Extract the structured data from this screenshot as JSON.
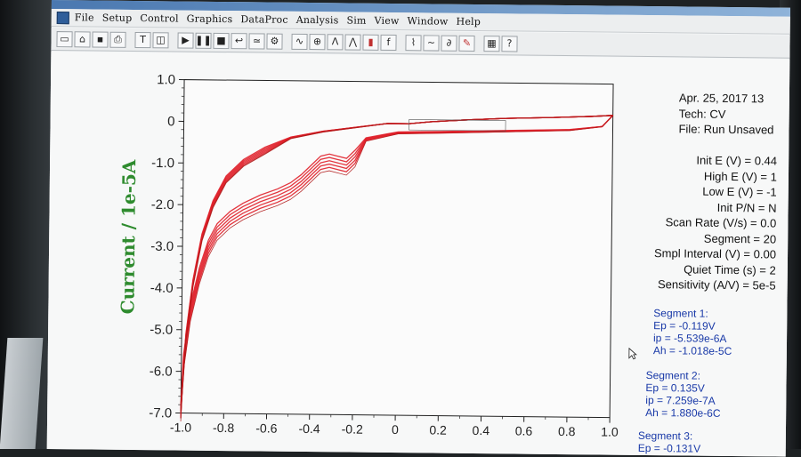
{
  "menu": {
    "items": [
      "File",
      "Setup",
      "Control",
      "Graphics",
      "DataProc",
      "Analysis",
      "Sim",
      "View",
      "Window",
      "Help"
    ]
  },
  "toolbar": {
    "icons": [
      "new-file-icon",
      "open-file-icon",
      "save-icon",
      "print-icon",
      "text-icon",
      "frame-icon",
      "run-icon",
      "pause-icon",
      "stop-icon",
      "reverse-icon",
      "smooth-icon",
      "settings-icon",
      "graph-icon",
      "zoom-icon",
      "peak-icon",
      "overlay-icon",
      "bar-chart-icon",
      "font-icon",
      "baseline-icon",
      "wave-icon",
      "derivative-icon",
      "pen-icon",
      "grid-icon",
      "help-icon"
    ]
  },
  "header": {
    "date": "Apr. 25, 2017   13",
    "tech": "Tech: CV",
    "file": "File: Run Unsaved"
  },
  "parameters": [
    "Init E (V) = 0.44",
    "High E (V) = 1",
    "Low E (V) = -1",
    "Init P/N = N",
    "Scan Rate (V/s) = 0.0",
    "Segment = 20",
    "Smpl Interval (V) = 0.00",
    "Quiet Time (s) = 2",
    "Sensitivity (A/V) = 5e-5"
  ],
  "segments": [
    {
      "title": "Segment 1:",
      "ep": "Ep = -0.119V",
      "ip": "ip = -5.539e-6A",
      "ah": "Ah = -1.018e-5C"
    },
    {
      "title": "Segment 2:",
      "ep": "Ep = 0.135V",
      "ip": "ip = 7.259e-7A",
      "ah": "Ah = 1.880e-6C"
    },
    {
      "title": "Segment 3:",
      "ep": "Ep = -0.131V"
    }
  ],
  "chart_data": {
    "type": "line",
    "ylabel": "Current / 1e-5A",
    "xlim": [
      -1.0,
      1.0
    ],
    "ylim": [
      -7.0,
      1.0
    ],
    "x_ticks": [
      "-1.0",
      "-0.8",
      "-0.6",
      "-0.4",
      "-0.2",
      "0",
      "0.2",
      "0.4",
      "0.6",
      "0.8",
      "1.0"
    ],
    "y_ticks": [
      "1.0",
      "0",
      "-1.0",
      "-2.0",
      "-3.0",
      "-4.0",
      "-5.0",
      "-6.0",
      "-7.0"
    ],
    "grid": false,
    "colors": {
      "trace": "#e0202a",
      "trace_dark": "#b01818",
      "ylabel": "#2e8b2e",
      "axis": "#222222"
    },
    "cycles": [
      {
        "offset": 0.0
      },
      {
        "offset": -0.08
      },
      {
        "offset": -0.16
      },
      {
        "offset": -0.24
      },
      {
        "offset": -0.32
      },
      {
        "offset": -0.4
      }
    ],
    "forward_sweep": [
      [
        -1.0,
        -6.8
      ],
      [
        -0.99,
        -5.6
      ],
      [
        -0.96,
        -4.4
      ],
      [
        -0.92,
        -3.5
      ],
      [
        -0.88,
        -2.85
      ],
      [
        -0.84,
        -2.45
      ],
      [
        -0.78,
        -2.15
      ],
      [
        -0.72,
        -1.95
      ],
      [
        -0.64,
        -1.75
      ],
      [
        -0.56,
        -1.6
      ],
      [
        -0.5,
        -1.45
      ],
      [
        -0.45,
        -1.25
      ],
      [
        -0.4,
        -1.0
      ],
      [
        -0.36,
        -0.8
      ],
      [
        -0.32,
        -0.75
      ],
      [
        -0.28,
        -0.8
      ],
      [
        -0.24,
        -0.85
      ],
      [
        -0.2,
        -0.65
      ],
      [
        -0.15,
        -0.35
      ],
      [
        -0.1,
        -0.3
      ],
      [
        -0.05,
        -0.25
      ],
      [
        0.0,
        -0.2
      ],
      [
        0.2,
        -0.18
      ],
      [
        0.5,
        -0.14
      ],
      [
        0.8,
        -0.1
      ],
      [
        0.95,
        -0.02
      ],
      [
        1.0,
        0.25
      ]
    ],
    "reverse_sweep": [
      [
        1.0,
        0.25
      ],
      [
        0.9,
        0.22
      ],
      [
        0.7,
        0.18
      ],
      [
        0.5,
        0.15
      ],
      [
        0.3,
        0.1
      ],
      [
        0.15,
        0.05
      ],
      [
        0.05,
        0.0
      ],
      [
        -0.05,
        0.0
      ],
      [
        -0.2,
        -0.1
      ],
      [
        -0.35,
        -0.2
      ],
      [
        -0.5,
        -0.35
      ],
      [
        -0.62,
        -0.6
      ],
      [
        -0.72,
        -0.9
      ],
      [
        -0.8,
        -1.3
      ],
      [
        -0.86,
        -1.9
      ],
      [
        -0.91,
        -2.7
      ],
      [
        -0.95,
        -3.8
      ],
      [
        -0.98,
        -5.1
      ],
      [
        -1.0,
        -6.8
      ]
    ]
  }
}
